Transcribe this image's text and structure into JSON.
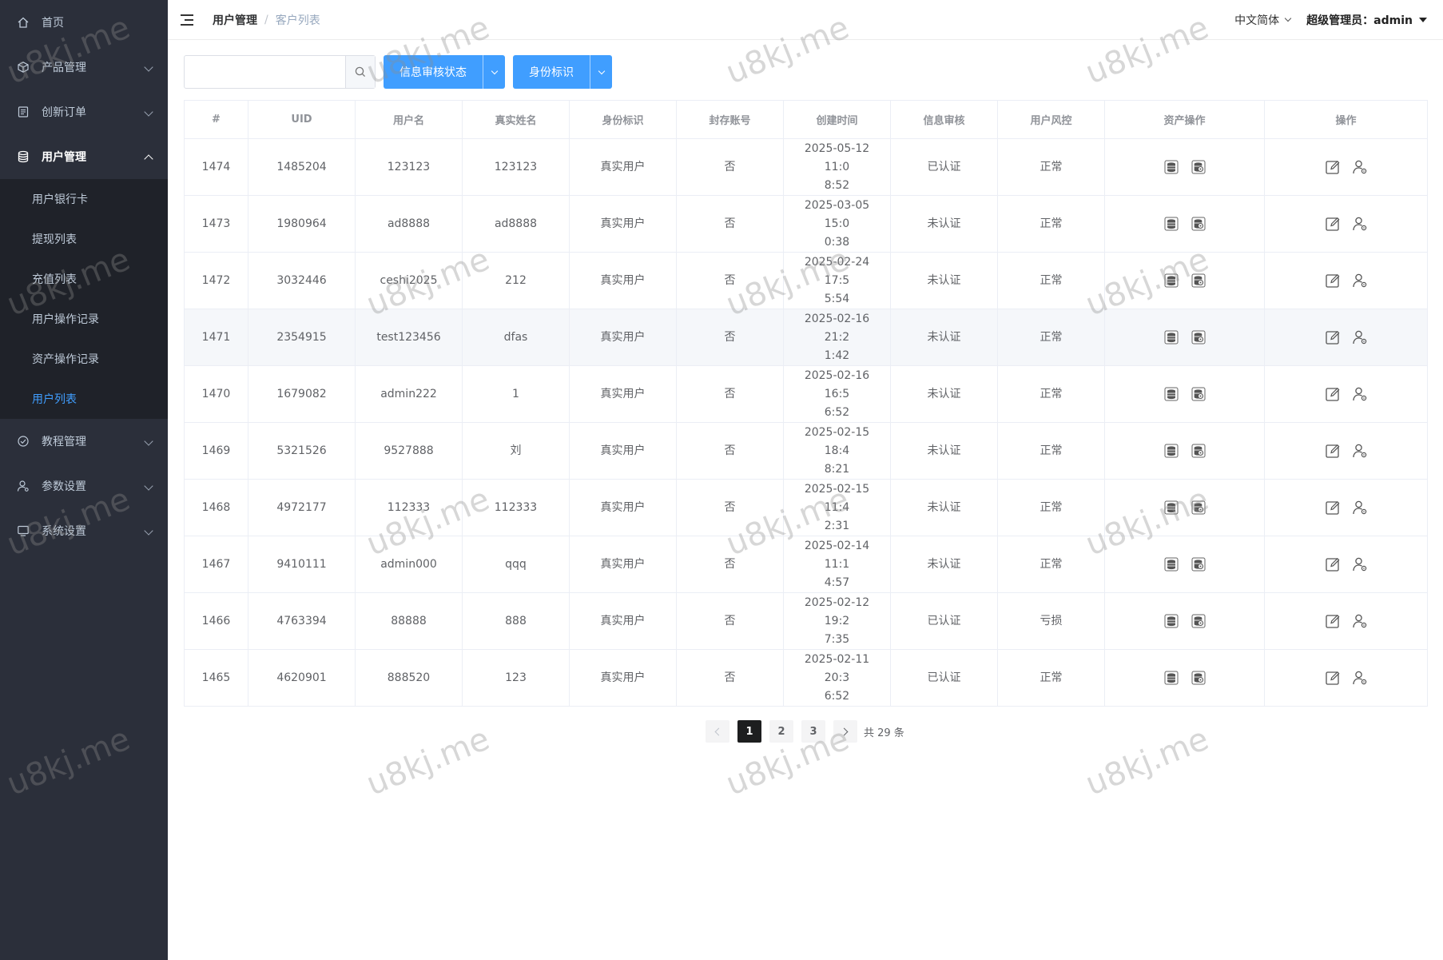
{
  "sidebar": {
    "menus": [
      {
        "label": "首页",
        "icon": "home-icon",
        "has_children": false
      },
      {
        "label": "产品管理",
        "icon": "cube-icon",
        "has_children": true
      },
      {
        "label": "创新订单",
        "icon": "order-list-icon",
        "has_children": true
      },
      {
        "label": "用户管理",
        "icon": "database-icon",
        "has_children": true,
        "expanded": true
      },
      {
        "label": "教程管理",
        "icon": "check-circle-icon",
        "has_children": true
      },
      {
        "label": "参数设置",
        "icon": "user-settings-icon",
        "has_children": true
      },
      {
        "label": "系统设置",
        "icon": "monitor-icon",
        "has_children": true
      }
    ],
    "user_submenu": [
      "用户银行卡",
      "提现列表",
      "充值列表",
      "用户操作记录",
      "资产操作记录",
      "用户列表"
    ],
    "active_sub": "用户列表"
  },
  "header": {
    "breadcrumb": [
      "用户管理",
      "客户列表"
    ],
    "language": "中文简体",
    "user": "超级管理员：admin"
  },
  "toolbar": {
    "search_value": "",
    "btn_review_status": "信息审核状态",
    "btn_identity": "身份标识"
  },
  "table": {
    "columns": [
      "#",
      "UID",
      "用户名",
      "真实姓名",
      "身份标识",
      "封存账号",
      "创建时间",
      "信息审核",
      "用户风控",
      "资产操作",
      "操作"
    ],
    "rows": [
      {
        "id": "1474",
        "uid": "1485204",
        "username": "123123",
        "realname": "123123",
        "identity": "真实用户",
        "sealed": "否",
        "created_1": "2025-05-12 11:0",
        "created_2": "8:52",
        "review": "已认证",
        "risk": "正常"
      },
      {
        "id": "1473",
        "uid": "1980964",
        "username": "ad8888",
        "realname": "ad8888",
        "identity": "真实用户",
        "sealed": "否",
        "created_1": "2025-03-05 15:0",
        "created_2": "0:38",
        "review": "未认证",
        "risk": "正常"
      },
      {
        "id": "1472",
        "uid": "3032446",
        "username": "ceshi2025",
        "realname": "212",
        "identity": "真实用户",
        "sealed": "否",
        "created_1": "2025-02-24 17:5",
        "created_2": "5:54",
        "review": "未认证",
        "risk": "正常"
      },
      {
        "id": "1471",
        "uid": "2354915",
        "username": "test123456",
        "realname": "dfas",
        "identity": "真实用户",
        "sealed": "否",
        "created_1": "2025-02-16 21:2",
        "created_2": "1:42",
        "review": "未认证",
        "risk": "正常"
      },
      {
        "id": "1470",
        "uid": "1679082",
        "username": "admin222",
        "realname": "1",
        "identity": "真实用户",
        "sealed": "否",
        "created_1": "2025-02-16 16:5",
        "created_2": "6:52",
        "review": "未认证",
        "risk": "正常"
      },
      {
        "id": "1469",
        "uid": "5321526",
        "username": "9527888",
        "realname": "刘",
        "identity": "真实用户",
        "sealed": "否",
        "created_1": "2025-02-15 18:4",
        "created_2": "8:21",
        "review": "未认证",
        "risk": "正常"
      },
      {
        "id": "1468",
        "uid": "4972177",
        "username": "112333",
        "realname": "112333",
        "identity": "真实用户",
        "sealed": "否",
        "created_1": "2025-02-15 11:4",
        "created_2": "2:31",
        "review": "未认证",
        "risk": "正常"
      },
      {
        "id": "1467",
        "uid": "9410111",
        "username": "admin000",
        "realname": "qqq",
        "identity": "真实用户",
        "sealed": "否",
        "created_1": "2025-02-14 11:1",
        "created_2": "4:57",
        "review": "未认证",
        "risk": "正常"
      },
      {
        "id": "1466",
        "uid": "4763394",
        "username": "88888",
        "realname": "888",
        "identity": "真实用户",
        "sealed": "否",
        "created_1": "2025-02-12 19:2",
        "created_2": "7:35",
        "review": "已认证",
        "risk": "亏损"
      },
      {
        "id": "1465",
        "uid": "4620901",
        "username": "888520",
        "realname": "123",
        "identity": "真实用户",
        "sealed": "否",
        "created_1": "2025-02-11 20:3",
        "created_2": "6:52",
        "review": "已认证",
        "risk": "正常"
      }
    ]
  },
  "pagination": {
    "pages": [
      "1",
      "2",
      "3"
    ],
    "current": "1",
    "total": "共 29 条"
  },
  "watermark": "u8kj.me",
  "colors": {
    "sidebar_bg": "#2b2f3a",
    "accent": "#409eff",
    "active_page": "#1d1e1f"
  }
}
